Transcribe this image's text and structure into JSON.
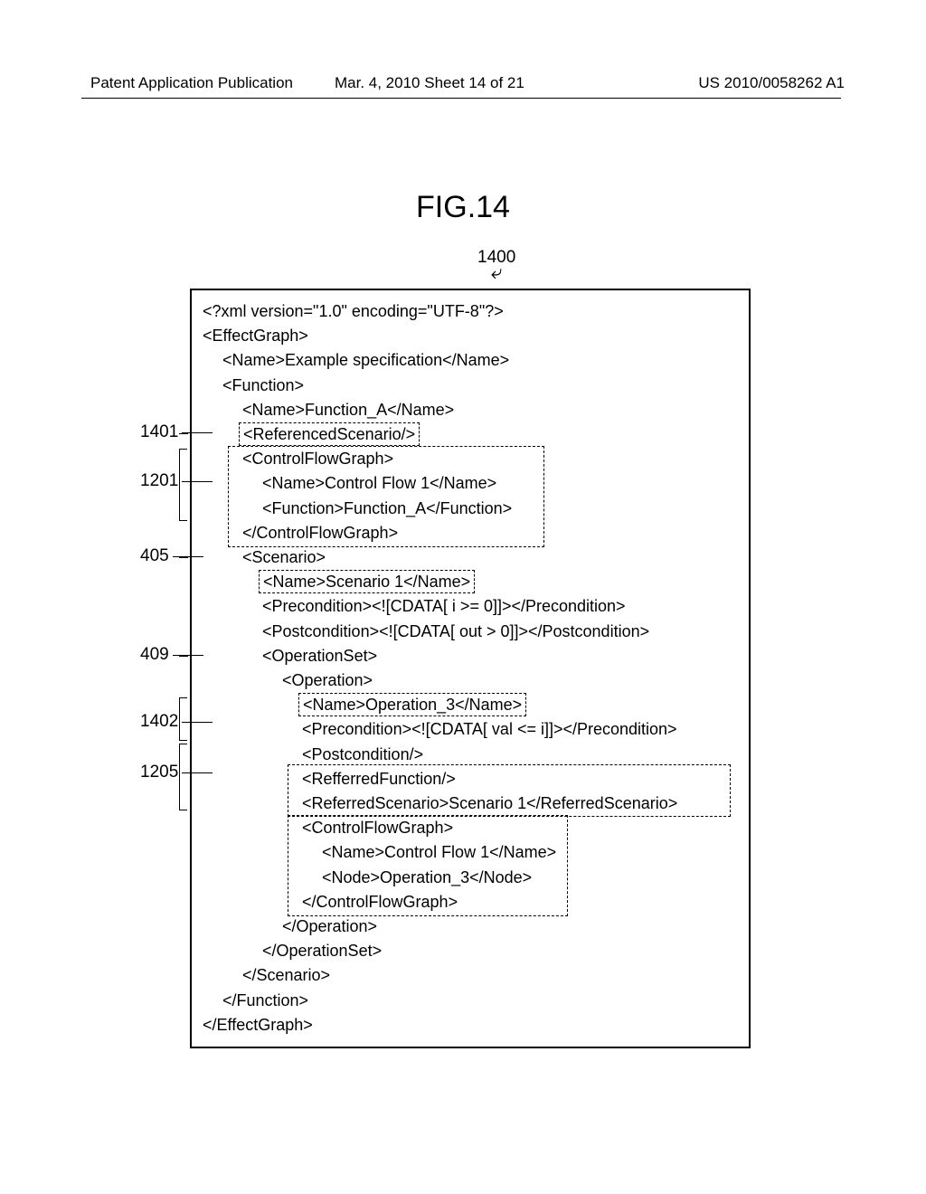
{
  "header": {
    "left": "Patent Application Publication",
    "center": "Mar. 4, 2010  Sheet 14 of 21",
    "right": "US 2010/0058262 A1"
  },
  "figure": {
    "title": "FIG.14",
    "callout_main": "1400"
  },
  "refs": {
    "r1401": "1401",
    "r1201": "1201",
    "r405": "405",
    "r409": "409",
    "r1402": "1402",
    "r1205": "1205"
  },
  "code": {
    "l01": "<?xml version=\"1.0\" encoding=\"UTF-8\"?>",
    "l02": "<EffectGraph>",
    "l03": "<Name>Example specification</Name>",
    "l04": "<Function>",
    "l05": "<Name>Function_A</Name>",
    "l06": "<ReferencedScenario/>",
    "l07": "<ControlFlowGraph>",
    "l08": "<Name>Control Flow 1</Name>",
    "l09": "<Function>Function_A</Function>",
    "l10": "</ControlFlowGraph>",
    "l11": "<Scenario>",
    "l12": "<Name>Scenario 1</Name>",
    "l13": "<Precondition><![CDATA[ i >= 0]]></Precondition>",
    "l14": "<Postcondition><![CDATA[ out > 0]]></Postcondition>",
    "l15": "<OperationSet>",
    "l16": "<Operation>",
    "l17": "<Name>Operation_3</Name>",
    "l18": "<Precondition><![CDATA[ val <= i]]></Precondition>",
    "l19": "<Postcondition/>",
    "l20": "<RefferredFunction/>",
    "l21": "<ReferredScenario>Scenario 1</ReferredScenario>",
    "l22": "<ControlFlowGraph>",
    "l23": "<Name>Control Flow 1</Name>",
    "l24": "<Node>Operation_3</Node>",
    "l25": "</ControlFlowGraph>",
    "l26": "</Operation>",
    "l27": "</OperationSet>",
    "l28": "</Scenario>",
    "l29": "</Function>",
    "l30": "</EffectGraph>"
  }
}
